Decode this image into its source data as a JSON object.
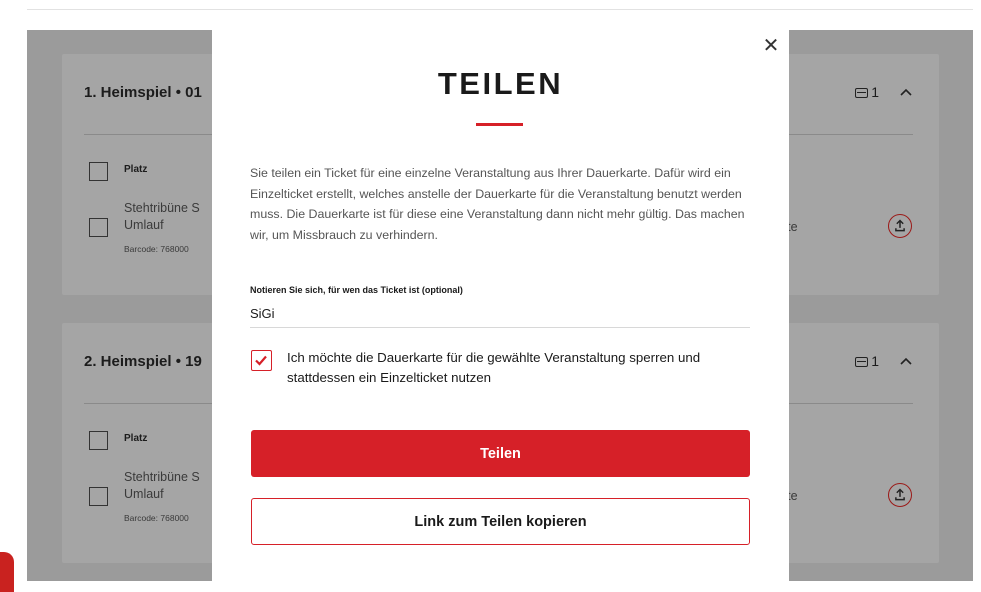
{
  "background": {
    "cards": [
      {
        "title": "1. Heimspiel • 01",
        "ticket_count": "1",
        "column_header": "Platz",
        "seat_line1": "Stehtribüne S",
        "seat_line2": "Umlauf",
        "barcode": "Barcode: 768000",
        "type_label": "arte"
      },
      {
        "title": "2. Heimspiel • 19",
        "ticket_count": "1",
        "column_header": "Platz",
        "seat_line1": "Stehtribüne S",
        "seat_line2": "Umlauf",
        "barcode": "Barcode: 768000",
        "type_label": "arte"
      }
    ]
  },
  "modal": {
    "close_icon": "close-icon",
    "title": "TEILEN",
    "description": "Sie teilen ein Ticket für eine einzelne Veranstaltung aus Ihrer Dauerkarte. Dafür wird ein Einzelticket erstellt, welches anstelle der Dauerkarte für die Veranstaltung benutzt werden muss. Die Dauerkarte ist für diese eine Veranstaltung dann nicht mehr gültig. Das machen wir, um Missbrauch zu verhindern.",
    "note_label": "Notieren Sie sich, für wen das Ticket ist (optional)",
    "note_value": "SiGi",
    "checkbox_checked": true,
    "checkbox_label": "Ich möchte die Dauerkarte für die gewählte Veranstaltung sperren und stattdessen ein Einzelticket nutzen",
    "primary_button": "Teilen",
    "secondary_button": "Link zum Teilen kopieren"
  },
  "colors": {
    "accent": "#d62028",
    "overlay": "#9b9b9b"
  }
}
